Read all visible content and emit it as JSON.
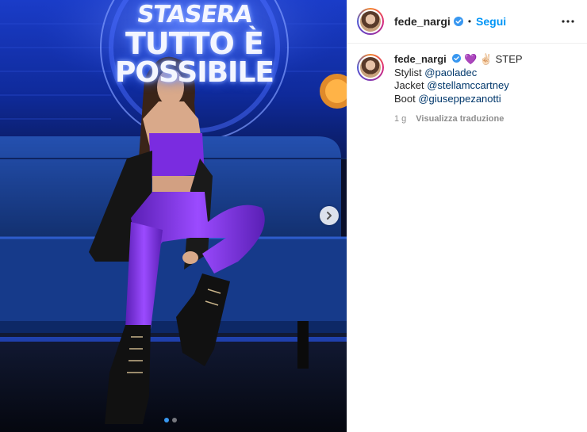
{
  "post": {
    "username": "fede_nargi",
    "follow_label": "Segui",
    "separator": "•",
    "show_title": {
      "line1": "STASERA",
      "line2": "TUTTO È",
      "line3": "POSSIBILE"
    },
    "carousel": {
      "current": 1,
      "total": 2
    }
  },
  "caption": {
    "username": "fede_nargi",
    "emoji_text": "💜 ✌🏻 STEP",
    "lines": [
      {
        "label": "Stylist ",
        "mention": "@paoladec"
      },
      {
        "label": "Jacket ",
        "mention": "@stellamccartney"
      },
      {
        "label": "Boot ",
        "mention": "@giuseppezanotti"
      }
    ],
    "time": "1 g",
    "translate_label": "Visualizza traduzione"
  },
  "colors": {
    "link": "#0095f6",
    "mention": "#00376b",
    "verified": "#3897f0",
    "outfit": "#7a2ce0",
    "sofa": "#1c3f8f"
  },
  "icons": [
    "verified-badge-icon",
    "more-options-icon",
    "chevron-right-icon"
  ]
}
